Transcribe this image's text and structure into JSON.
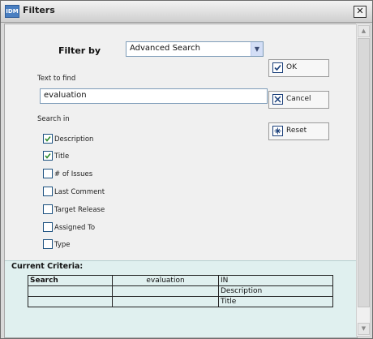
{
  "window": {
    "title": "Filters",
    "app_icon_text": "IDM"
  },
  "filter": {
    "label": "Filter by",
    "selected": "Advanced Search",
    "text_label": "Text to find",
    "text_value": "evaluation",
    "search_in_label": "Search in"
  },
  "buttons": {
    "ok": "OK",
    "cancel": "Cancel",
    "reset": "Reset"
  },
  "checkboxes": [
    {
      "label": "Description",
      "checked": true
    },
    {
      "label": "Title",
      "checked": true
    },
    {
      "label": "# of Issues",
      "checked": false
    },
    {
      "label": "Last Comment",
      "checked": false
    },
    {
      "label": "Target Release",
      "checked": false
    },
    {
      "label": "Assigned To",
      "checked": false
    },
    {
      "label": "Type",
      "checked": false
    }
  ],
  "criteria": {
    "title": "Current Criteria:",
    "rows": [
      [
        "Search",
        "evaluation",
        "IN"
      ],
      [
        "",
        "",
        "Description"
      ],
      [
        "",
        "",
        "Title"
      ]
    ]
  },
  "icons": {
    "close": "close-icon",
    "dropdown": "chevron-down-icon",
    "ok": "check-icon",
    "cancel": "cancel-icon",
    "reset": "reset-icon",
    "scroll_up": "arrow-up-icon",
    "scroll_down": "arrow-down-icon"
  },
  "colors": {
    "accent": "#1c5180",
    "criteria_bg": "#e0f0ef"
  }
}
